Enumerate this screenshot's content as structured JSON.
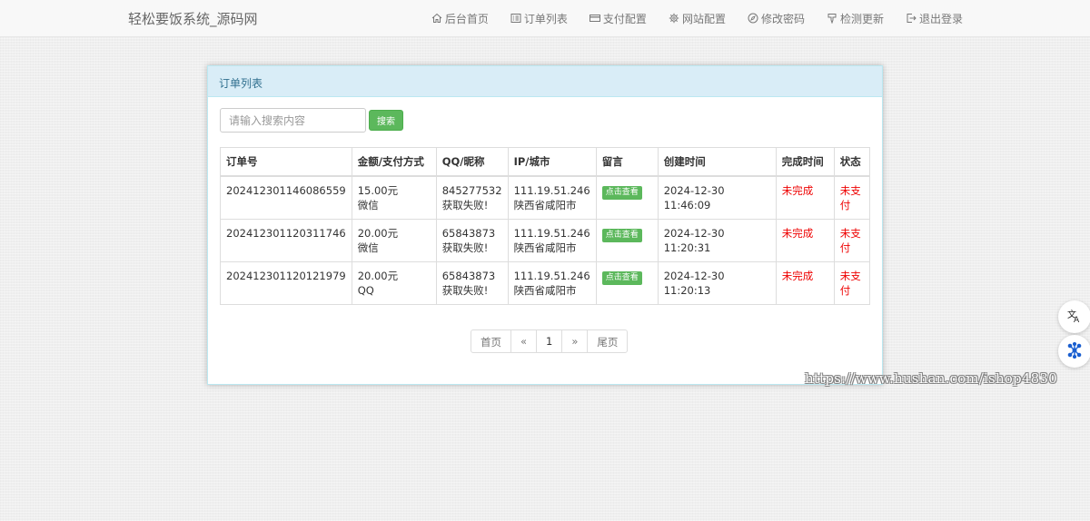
{
  "brand": "轻松要饭系统_源码网",
  "nav": [
    {
      "label": "后台首页",
      "icon": "home-icon"
    },
    {
      "label": "订单列表",
      "icon": "list-icon"
    },
    {
      "label": "支付配置",
      "icon": "credit-card-icon"
    },
    {
      "label": "网站配置",
      "icon": "gear-icon"
    },
    {
      "label": "修改密码",
      "icon": "compass-icon"
    },
    {
      "label": "检测更新",
      "icon": "pin-icon"
    },
    {
      "label": "退出登录",
      "icon": "logout-icon"
    }
  ],
  "panel": {
    "title": "订单列表",
    "search_placeholder": "请输入搜索内容",
    "search_button": "搜索"
  },
  "table": {
    "headers": [
      "订单号",
      "金额/支付方式",
      "QQ/昵称",
      "IP/城市",
      "留言",
      "创建时间",
      "完成时间",
      "状态"
    ],
    "rows": [
      {
        "order_no": "202412301146086559",
        "amount": "15.00元",
        "pay_method": "微信",
        "qq": "845277532",
        "nickname": "获取失败!",
        "ip": "111.19.51.246",
        "city": "陕西省咸阳市",
        "message_btn": "点击查看",
        "created": "2024-12-30 11:46:09",
        "finished": "未完成",
        "status": "未支付"
      },
      {
        "order_no": "202412301120311746",
        "amount": "20.00元",
        "pay_method": "微信",
        "qq": "65843873",
        "nickname": "获取失败!",
        "ip": "111.19.51.246",
        "city": "陕西省咸阳市",
        "message_btn": "点击查看",
        "created": "2024-12-30 11:20:31",
        "finished": "未完成",
        "status": "未支付"
      },
      {
        "order_no": "202412301120121979",
        "amount": "20.00元",
        "pay_method": "QQ",
        "qq": "65843873",
        "nickname": "获取失败!",
        "ip": "111.19.51.246",
        "city": "陕西省咸阳市",
        "message_btn": "点击查看",
        "created": "2024-12-30 11:20:13",
        "finished": "未完成",
        "status": "未支付"
      }
    ]
  },
  "pagination": [
    "首页",
    "«",
    "1",
    "»",
    "尾页"
  ],
  "watermark": "https://www.hushan.com/ishop4830",
  "colors": {
    "accent_green": "#5cb85c",
    "panel_heading": "#d9edf7",
    "panel_heading_text": "#31708f",
    "status_red": "#e00000",
    "float_icon_blue": "#1a5fd0"
  }
}
